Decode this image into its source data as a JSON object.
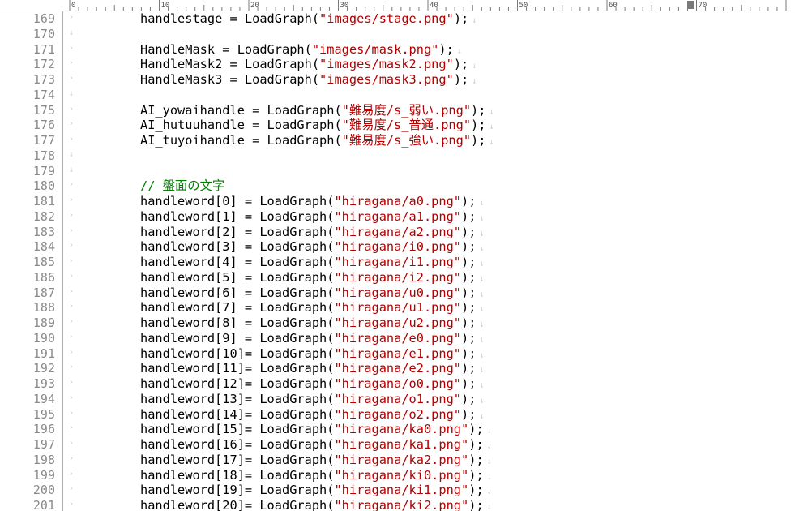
{
  "ruler": {
    "labels": [
      "0",
      "10",
      "20",
      "30",
      "40",
      "50",
      "60",
      "70"
    ]
  },
  "editor": {
    "lines": [
      {
        "num": "169",
        "code": "handlestage = LoadGraph(\"images/stage.png\");",
        "kind": "code"
      },
      {
        "num": "170",
        "code": "",
        "kind": "empty"
      },
      {
        "num": "171",
        "code": "HandleMask = LoadGraph(\"images/mask.png\");",
        "kind": "code"
      },
      {
        "num": "172",
        "code": "HandleMask2 = LoadGraph(\"images/mask2.png\");",
        "kind": "code"
      },
      {
        "num": "173",
        "code": "HandleMask3 = LoadGraph(\"images/mask3.png\");",
        "kind": "code"
      },
      {
        "num": "174",
        "code": "",
        "kind": "empty"
      },
      {
        "num": "175",
        "code": "AI_yowaihandle = LoadGraph(\"難易度/s_弱い.png\");",
        "kind": "code"
      },
      {
        "num": "176",
        "code": "AI_hutuuhandle = LoadGraph(\"難易度/s_普通.png\");",
        "kind": "code"
      },
      {
        "num": "177",
        "code": "AI_tuyoihandle = LoadGraph(\"難易度/s_強い.png\");",
        "kind": "code"
      },
      {
        "num": "178",
        "code": "",
        "kind": "empty"
      },
      {
        "num": "179",
        "code": "",
        "kind": "empty"
      },
      {
        "num": "180",
        "code": "// 盤面の文字",
        "kind": "comment"
      },
      {
        "num": "181",
        "code": "handleword[0] = LoadGraph(\"hiragana/a0.png\");",
        "kind": "code"
      },
      {
        "num": "182",
        "code": "handleword[1] = LoadGraph(\"hiragana/a1.png\");",
        "kind": "code"
      },
      {
        "num": "183",
        "code": "handleword[2] = LoadGraph(\"hiragana/a2.png\");",
        "kind": "code"
      },
      {
        "num": "184",
        "code": "handleword[3] = LoadGraph(\"hiragana/i0.png\");",
        "kind": "code"
      },
      {
        "num": "185",
        "code": "handleword[4] = LoadGraph(\"hiragana/i1.png\");",
        "kind": "code"
      },
      {
        "num": "186",
        "code": "handleword[5] = LoadGraph(\"hiragana/i2.png\");",
        "kind": "code"
      },
      {
        "num": "187",
        "code": "handleword[6] = LoadGraph(\"hiragana/u0.png\");",
        "kind": "code"
      },
      {
        "num": "188",
        "code": "handleword[7] = LoadGraph(\"hiragana/u1.png\");",
        "kind": "code"
      },
      {
        "num": "189",
        "code": "handleword[8] = LoadGraph(\"hiragana/u2.png\");",
        "kind": "code"
      },
      {
        "num": "190",
        "code": "handleword[9] = LoadGraph(\"hiragana/e0.png\");",
        "kind": "code"
      },
      {
        "num": "191",
        "code": "handleword[10]= LoadGraph(\"hiragana/e1.png\");",
        "kind": "code"
      },
      {
        "num": "192",
        "code": "handleword[11]= LoadGraph(\"hiragana/e2.png\");",
        "kind": "code"
      },
      {
        "num": "193",
        "code": "handleword[12]= LoadGraph(\"hiragana/o0.png\");",
        "kind": "code"
      },
      {
        "num": "194",
        "code": "handleword[13]= LoadGraph(\"hiragana/o1.png\");",
        "kind": "code"
      },
      {
        "num": "195",
        "code": "handleword[14]= LoadGraph(\"hiragana/o2.png\");",
        "kind": "code"
      },
      {
        "num": "196",
        "code": "handleword[15]= LoadGraph(\"hiragana/ka0.png\");",
        "kind": "code"
      },
      {
        "num": "197",
        "code": "handleword[16]= LoadGraph(\"hiragana/ka1.png\");",
        "kind": "code"
      },
      {
        "num": "198",
        "code": "handleword[17]= LoadGraph(\"hiragana/ka2.png\");",
        "kind": "code"
      },
      {
        "num": "199",
        "code": "handleword[18]= LoadGraph(\"hiragana/ki0.png\");",
        "kind": "code"
      },
      {
        "num": "200",
        "code": "handleword[19]= LoadGraph(\"hiragana/ki1.png\");",
        "kind": "code"
      },
      {
        "num": "201",
        "code": "handleword[20]= LoadGraph(\"hiragana/ki2.png\");",
        "kind": "code"
      }
    ]
  },
  "colors": {
    "string": "#b30000",
    "comment": "#008000",
    "text": "#000000",
    "line_number": "#8a8a8a",
    "background": "#ffffff"
  },
  "icons": {
    "tab_marker": "tab-arrow-icon",
    "line_end_marker": "line-end-icon",
    "cursor_column_marker": "cursor-column-icon"
  }
}
